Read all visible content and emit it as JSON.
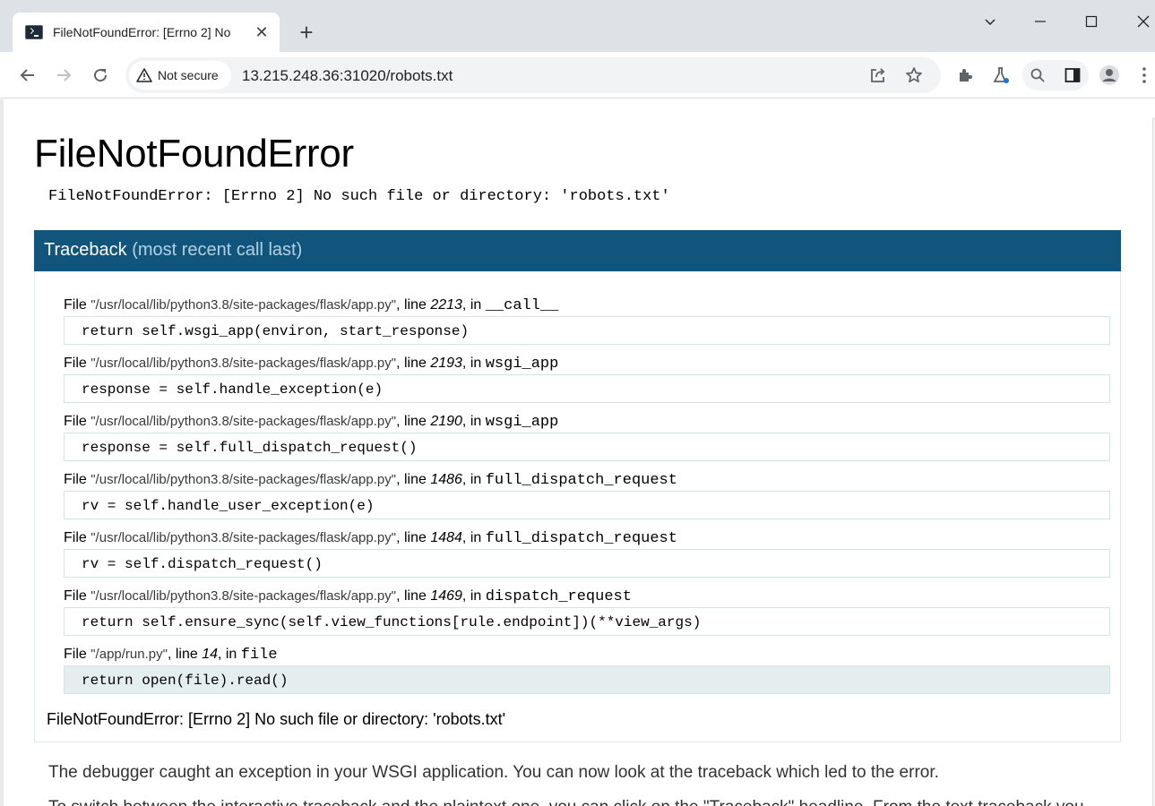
{
  "browser": {
    "tab_title": "FileNotFoundError: [Errno 2] No",
    "security_label": "Not secure",
    "url": "13.215.248.36:31020/robots.txt",
    "icons": [
      "back-icon",
      "forward-icon",
      "reload-icon",
      "warning-icon",
      "share-icon",
      "star-icon",
      "extensions-icon",
      "labs-icon",
      "search-icon",
      "side-panel-icon",
      "profile-icon",
      "more-icon"
    ]
  },
  "page": {
    "title": "FileNotFoundError",
    "message": "FileNotFoundError: [Errno 2] No such file or directory: 'robots.txt'",
    "traceback_label": "Traceback",
    "traceback_sub": "(most recent call last)",
    "frames": [
      {
        "file_prefix": "File ",
        "file": "\"/usr/local/lib/python3.8/site-packages/flask/app.py\"",
        "line_label": ", line ",
        "line": "2213",
        "in_label": ", in ",
        "func": "__call__",
        "code": "return self.wsgi_app(environ, start_response)"
      },
      {
        "file_prefix": "File ",
        "file": "\"/usr/local/lib/python3.8/site-packages/flask/app.py\"",
        "line_label": ", line ",
        "line": "2193",
        "in_label": ", in ",
        "func": "wsgi_app",
        "code": "response = self.handle_exception(e)"
      },
      {
        "file_prefix": "File ",
        "file": "\"/usr/local/lib/python3.8/site-packages/flask/app.py\"",
        "line_label": ", line ",
        "line": "2190",
        "in_label": ", in ",
        "func": "wsgi_app",
        "code": "response = self.full_dispatch_request()"
      },
      {
        "file_prefix": "File ",
        "file": "\"/usr/local/lib/python3.8/site-packages/flask/app.py\"",
        "line_label": ", line ",
        "line": "1486",
        "in_label": ", in ",
        "func": "full_dispatch_request",
        "code": "rv = self.handle_user_exception(e)"
      },
      {
        "file_prefix": "File ",
        "file": "\"/usr/local/lib/python3.8/site-packages/flask/app.py\"",
        "line_label": ", line ",
        "line": "1484",
        "in_label": ", in ",
        "func": "full_dispatch_request",
        "code": "rv = self.dispatch_request()"
      },
      {
        "file_prefix": "File ",
        "file": "\"/usr/local/lib/python3.8/site-packages/flask/app.py\"",
        "line_label": ", line ",
        "line": "1469",
        "in_label": ", in ",
        "func": "dispatch_request",
        "code": "return self.ensure_sync(self.view_functions[rule.endpoint])(**view_args)"
      },
      {
        "file_prefix": "File ",
        "file": "\"/app/run.py\"",
        "line_label": ", line ",
        "line": "14",
        "in_label": ", in ",
        "func": "file",
        "code": "return open(file).read()"
      }
    ],
    "final_exception": "FileNotFoundError: [Errno 2] No such file or directory: 'robots.txt'",
    "explanation": "The debugger caught an exception in your WSGI application. You can now look at the traceback which led to the error.",
    "explanation2": "To switch between the interactive traceback and the plaintext one, you can click on the \"Traceback\" headline. From the text traceback you"
  }
}
